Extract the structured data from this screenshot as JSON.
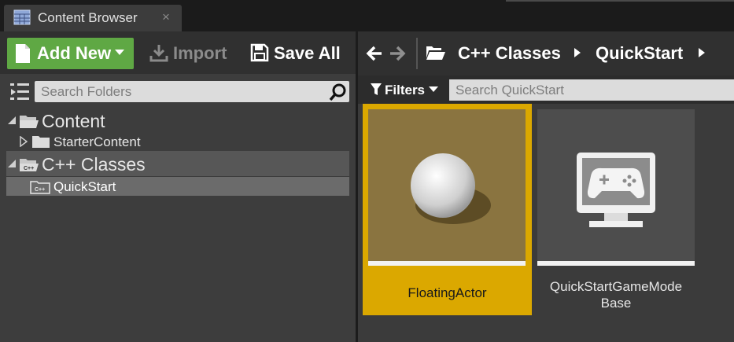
{
  "tab": {
    "title": "Content Browser",
    "close": "×",
    "icon": "grid-icon"
  },
  "toolbar": {
    "add_new": "Add New",
    "import": "Import",
    "save_all": "Save All"
  },
  "folders": {
    "search_placeholder": "Search Folders",
    "tree": [
      {
        "label": "Content",
        "expanded": true
      },
      {
        "label": "StarterContent",
        "expanded": false
      },
      {
        "label": "C++ Classes",
        "expanded": true
      },
      {
        "label": "QuickStart",
        "selected": true
      }
    ]
  },
  "breadcrumb": {
    "items": [
      "C++ Classes",
      "QuickStart"
    ]
  },
  "assets": {
    "filters_label": "Filters",
    "search_placeholder": "Search QuickStart",
    "items": [
      {
        "name": "FloatingActor",
        "selected": true
      },
      {
        "name_line1": "QuickStartGameMode",
        "name_line2": "Base"
      }
    ]
  },
  "colors": {
    "accent_green": "#5fa844",
    "selection_gold": "#dba800",
    "panel_bg": "#3d3d3d"
  }
}
